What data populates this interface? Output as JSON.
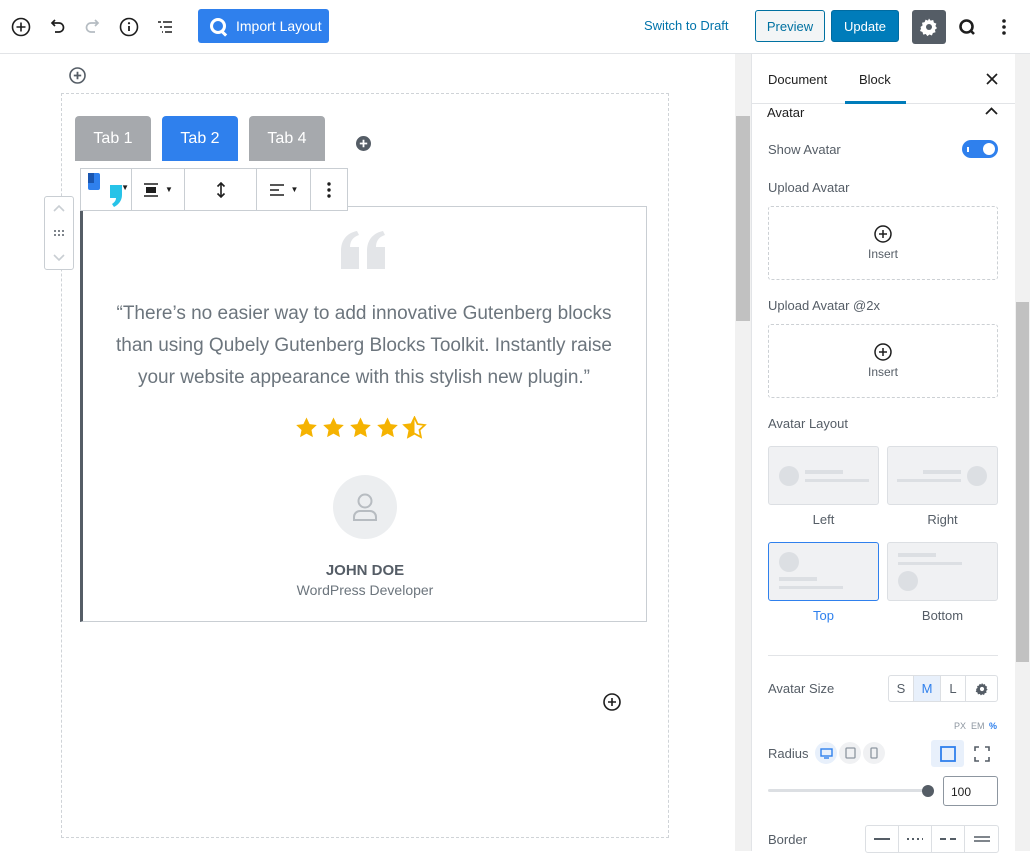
{
  "toolbar": {
    "import_label": "Import Layout",
    "switch_draft_label": "Switch to Draft",
    "preview_label": "Preview",
    "update_label": "Update"
  },
  "tabs": [
    {
      "label": "Tab 1",
      "active": false
    },
    {
      "label": "Tab 2",
      "active": true
    },
    {
      "label": "Tab 4",
      "active": false
    }
  ],
  "testimonial": {
    "quote": "“There’s no easier way to add innovative Gutenberg blocks than using Qubely Gutenberg Blocks Toolkit. Instantly raise your website appearance with this stylish new plugin.”",
    "rating": 4.5,
    "author_name": "JOHN DOE",
    "author_role": "WordPress Developer"
  },
  "sidebar": {
    "tab_document": "Document",
    "tab_block": "Block",
    "section_title": "Avatar",
    "show_avatar_label": "Show Avatar",
    "show_avatar_on": true,
    "upload_avatar_label": "Upload Avatar",
    "upload_avatar2x_label": "Upload Avatar @2x",
    "insert_label": "Insert",
    "avatar_layout_label": "Avatar Layout",
    "layouts": [
      {
        "label": "Left",
        "selected": false
      },
      {
        "label": "Right",
        "selected": false
      },
      {
        "label": "Top",
        "selected": true
      },
      {
        "label": "Bottom",
        "selected": false
      }
    ],
    "avatar_size_label": "Avatar Size",
    "size_options": [
      "S",
      "M",
      "L"
    ],
    "size_selected": "M",
    "units": [
      "PX",
      "EM",
      "%"
    ],
    "unit_selected": "%",
    "radius_label": "Radius",
    "radius_value": "100",
    "border_label": "Border"
  },
  "colors": {
    "accent": "#2f80ed",
    "wp_blue": "#007cba",
    "star": "#f5b301",
    "tab_inactive": "#a6a9ad"
  }
}
